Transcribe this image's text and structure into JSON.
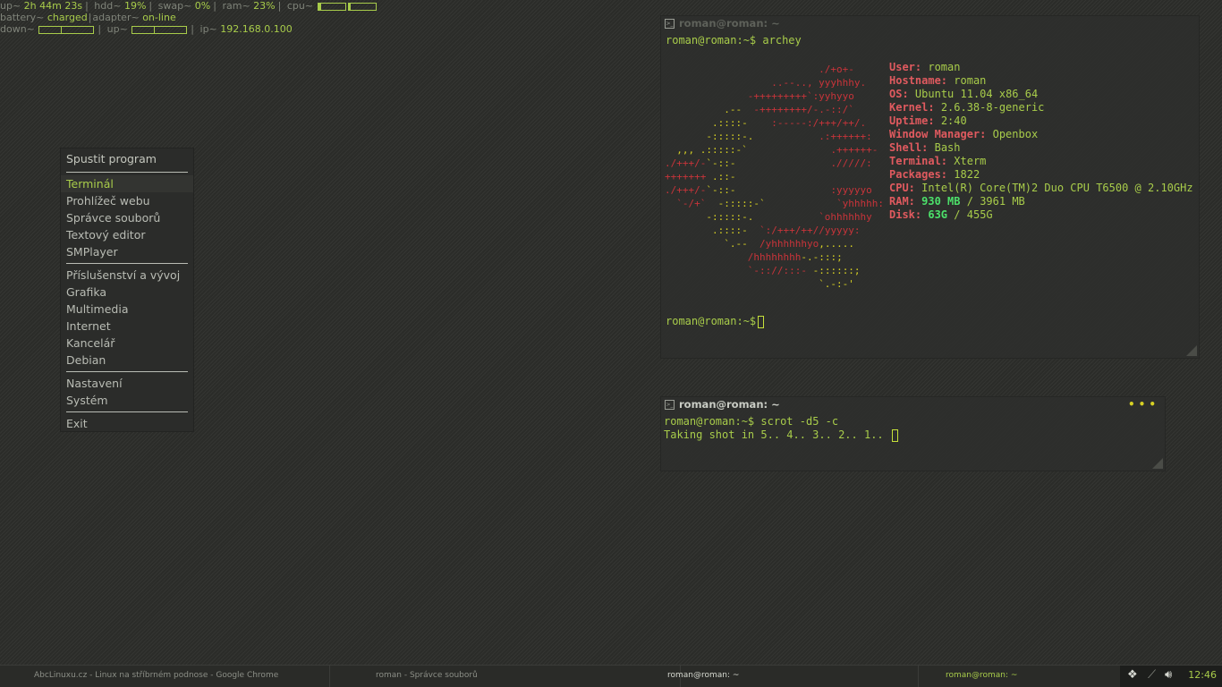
{
  "conky": {
    "up_label": "up~",
    "up_value": "2h 44m 23s",
    "hdd_label": "hdd~",
    "hdd_value": "19%",
    "swap_label": "swap~",
    "swap_value": "0%",
    "ram_label": "ram~",
    "ram_value": "23%",
    "cpu_label": "cpu~",
    "battery_label": "battery~",
    "battery_value": "charged",
    "adapter_label": "adapter~",
    "adapter_value": "on-line",
    "down_label": "down~",
    "upload_label": "up~",
    "ip_label": "ip~",
    "ip_value": "192.168.0.100"
  },
  "menu": {
    "title": "Spustit program",
    "group1": [
      "Terminál",
      "Prohlížeč webu",
      "Správce souborů",
      "Textový editor",
      "SMPlayer"
    ],
    "group2": [
      "Příslušenství a vývoj",
      "Grafika",
      "Multimedia",
      "Internet",
      "Kancelář",
      "Debian"
    ],
    "group3": [
      "Nastavení",
      "Systém"
    ],
    "group4": [
      "Exit"
    ],
    "active_item": "Terminál"
  },
  "terminal1": {
    "title": "roman@roman: ~",
    "prompt": "roman@roman:~$",
    "command": "archey",
    "info": [
      {
        "key": "User:",
        "value": "roman"
      },
      {
        "key": "Hostname:",
        "value": "roman"
      },
      {
        "key": "OS:",
        "value": "Ubuntu 11.04 x86_64"
      },
      {
        "key": "Kernel:",
        "value": "2.6.38-8-generic"
      },
      {
        "key": "Uptime:",
        "value": "2:40"
      },
      {
        "key": "Window Manager:",
        "value": "Openbox"
      },
      {
        "key": "Shell:",
        "value": "Bash"
      },
      {
        "key": "Terminal:",
        "value": "Xterm"
      },
      {
        "key": "Packages:",
        "value": "1822"
      },
      {
        "key": "CPU:",
        "value": "Intel(R) Core(TM)2 Duo CPU T6500 @ 2.10GHz"
      }
    ],
    "ram": {
      "key": "RAM:",
      "used": "930 MB",
      "sep": "/",
      "total": "3961 MB"
    },
    "disk": {
      "key": "Disk:",
      "used": "63G",
      "sep": "/",
      "total": "455G"
    }
  },
  "terminal2": {
    "title": "roman@roman: ~",
    "prompt": "roman@roman:~$",
    "command": "scrot -d5 -c",
    "output": "Taking shot in 5.. 4.. 3.. 2.. 1.."
  },
  "taskbar": {
    "tasks": [
      "AbcLinuxu.cz - Linux na stříbrném podnose - Google Chrome",
      "roman - Správce souborů",
      "roman@roman: ~",
      "roman@roman: ~"
    ],
    "clock": "12:46"
  },
  "colors": {
    "accent": "#a8cc4a",
    "red": "#c8343a",
    "yellow": "#d6d024"
  }
}
